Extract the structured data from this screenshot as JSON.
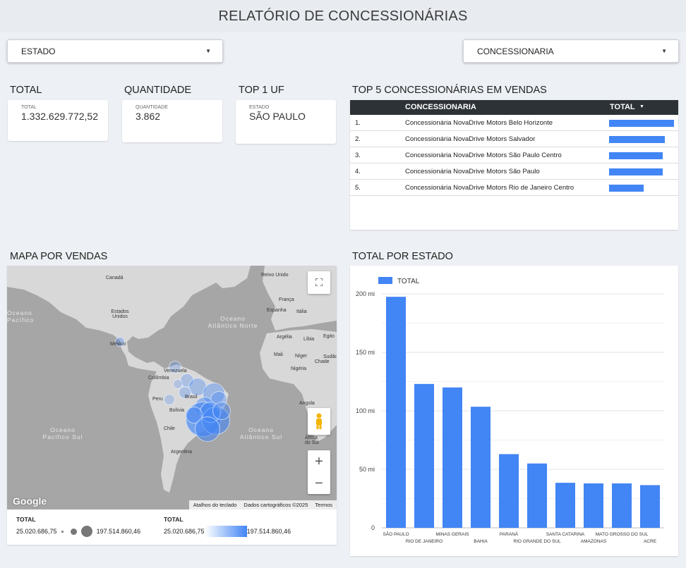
{
  "page": {
    "title": "RELATÓRIO DE CONCESSIONÁRIAS",
    "filters": {
      "estado": "ESTADO",
      "concessionaria": "CONCESSIONARIA"
    }
  },
  "kpis": {
    "total": {
      "title": "TOTAL",
      "label": "TOTAL",
      "value": "1.332.629.772,52"
    },
    "quantidade": {
      "title": "QUANTIDADE",
      "label": "QUANTIDADE",
      "value": "3.862"
    },
    "top_uf": {
      "title": "TOP 1 UF",
      "label": "ESTADO",
      "value": "SÃO PAULO"
    }
  },
  "top5": {
    "title": "TOP 5 CONCESSIONÁRIAS EM VENDAS",
    "col_name": "CONCESSIONARIA",
    "col_total": "TOTAL",
    "sort_icon": "sort-desc-icon",
    "rows": [
      {
        "rank": "1.",
        "name": "Concessionária NovaDrive Motors Belo Horizonte",
        "share": 1.0
      },
      {
        "rank": "2.",
        "name": "Concessionária NovaDrive Motors Salvador",
        "share": 0.86
      },
      {
        "rank": "3.",
        "name": "Concessionária NovaDrive Motors São Paulo Centro",
        "share": 0.83
      },
      {
        "rank": "4.",
        "name": "Concessionária NovaDrive Motors São Paulo",
        "share": 0.83
      },
      {
        "rank": "5.",
        "name": "Concessionária NovaDrive Motors Rio de Janeiro Centro",
        "share": 0.53
      }
    ]
  },
  "map": {
    "title": "MAPA POR VENDAS",
    "labels": [
      "Canadá",
      "Estados Unidos",
      "México",
      "Venezuela",
      "Colômbia",
      "Brasil",
      "Peru",
      "Bolívia",
      "Chile",
      "Argentina",
      "Reino Unido",
      "França",
      "Espanha",
      "Itália",
      "Argélia",
      "Líbia",
      "Egito",
      "Mali",
      "Níger",
      "Chade",
      "Nigéria",
      "Sudão",
      "Angola",
      "África do Sul"
    ],
    "oceans": [
      "Oceano Atlântico Norte",
      "Oceano Pacífico Sul",
      "Oceano Atlântico Sul",
      "Oceano Pacífico"
    ],
    "google": "Google",
    "attr_keyboard": "Atalhos do teclado",
    "attr_data": "Dados cartográficos ©2025",
    "attr_terms": "Termos",
    "legend_size": {
      "title": "TOTAL",
      "min": "25.020.686,75",
      "max": "197.514.860,46"
    },
    "legend_color": {
      "title": "TOTAL",
      "min": "25.020.686,75",
      "max": "197.514.860,46",
      "color_low": "#ffffff",
      "color_high": "#4285f4"
    },
    "icons": {
      "fullscreen": "fullscreen-icon",
      "pegman": "pegman-icon",
      "zoom_in": "plus-icon",
      "zoom_out": "minus-icon"
    }
  },
  "chart_data": {
    "type": "bar",
    "title": "TOTAL POR ESTADO",
    "legend": "TOTAL",
    "legend_position": "top-left",
    "color": "#4285f4",
    "categories": [
      "SÃO PAULO",
      "RIO DE JANEIRO",
      "MINAS GERAIS",
      "BAHIA",
      "PARANÁ",
      "RIO GRANDE DO SUL",
      "SANTA CATARINA",
      "AMAZONAS",
      "MATO GROSSO DO SUL",
      "ACRE"
    ],
    "values": [
      197.5,
      123,
      120,
      103.5,
      63,
      55,
      38.5,
      38,
      38,
      36.5
    ],
    "value_unit": "mi",
    "yticks": [
      "0",
      "50 mi",
      "100 mi",
      "150 mi",
      "200 mi"
    ],
    "ylim": [
      0,
      200
    ],
    "grid": true
  }
}
